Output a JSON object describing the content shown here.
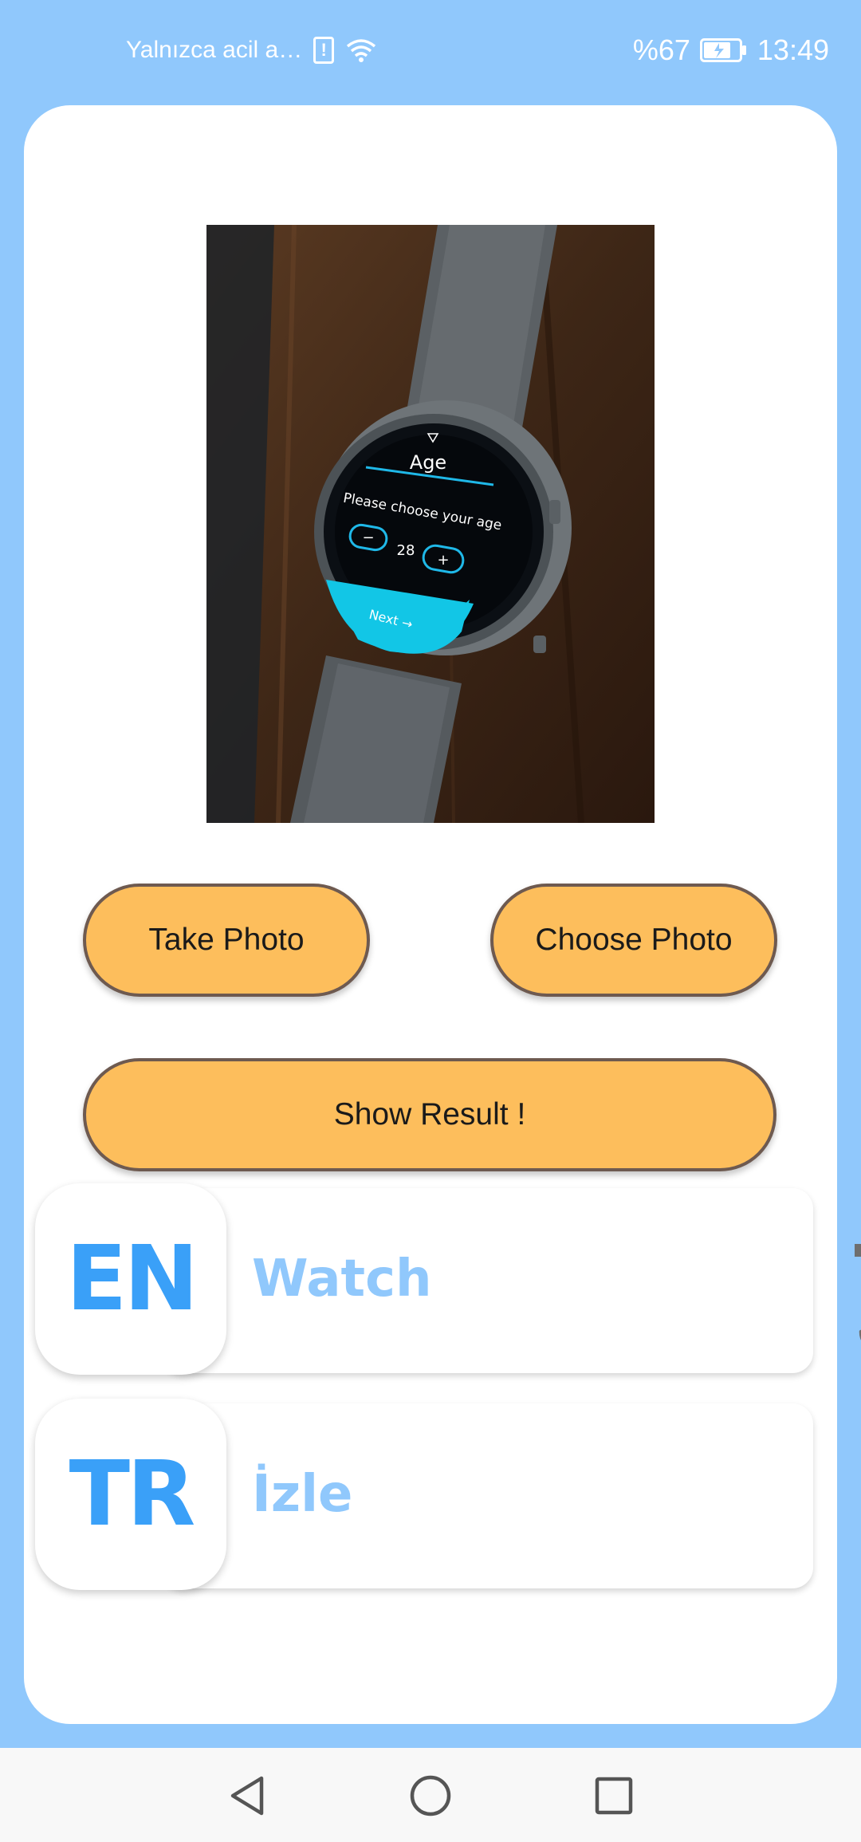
{
  "status_bar": {
    "carrier_text": "Yalnızca acil a…",
    "alert_glyph": "!",
    "battery_percent": "%67",
    "time": "13:49"
  },
  "photo": {
    "screen_title": "Age",
    "screen_prompt": "Please choose your age",
    "minus_label": "−",
    "age_value": "28",
    "plus_label": "+",
    "next_label": "Next →"
  },
  "buttons": {
    "take_photo": "Take Photo",
    "choose_photo": "Choose Photo",
    "show_result": "Show Result !"
  },
  "languages": [
    {
      "code": "EN",
      "word": "Watch"
    },
    {
      "code": "TR",
      "word": "İzle"
    }
  ],
  "icons": {
    "speaker": "speaker-icon",
    "mic": "microphone-icon",
    "back": "back-icon",
    "home": "home-icon",
    "recent": "recent-apps-icon"
  },
  "colors": {
    "background": "#90C8FC",
    "button": "#FDBE5C",
    "button_border": "#6E5A50",
    "badge_text": "#3AA0F8",
    "word_text": "#90C8FC"
  }
}
